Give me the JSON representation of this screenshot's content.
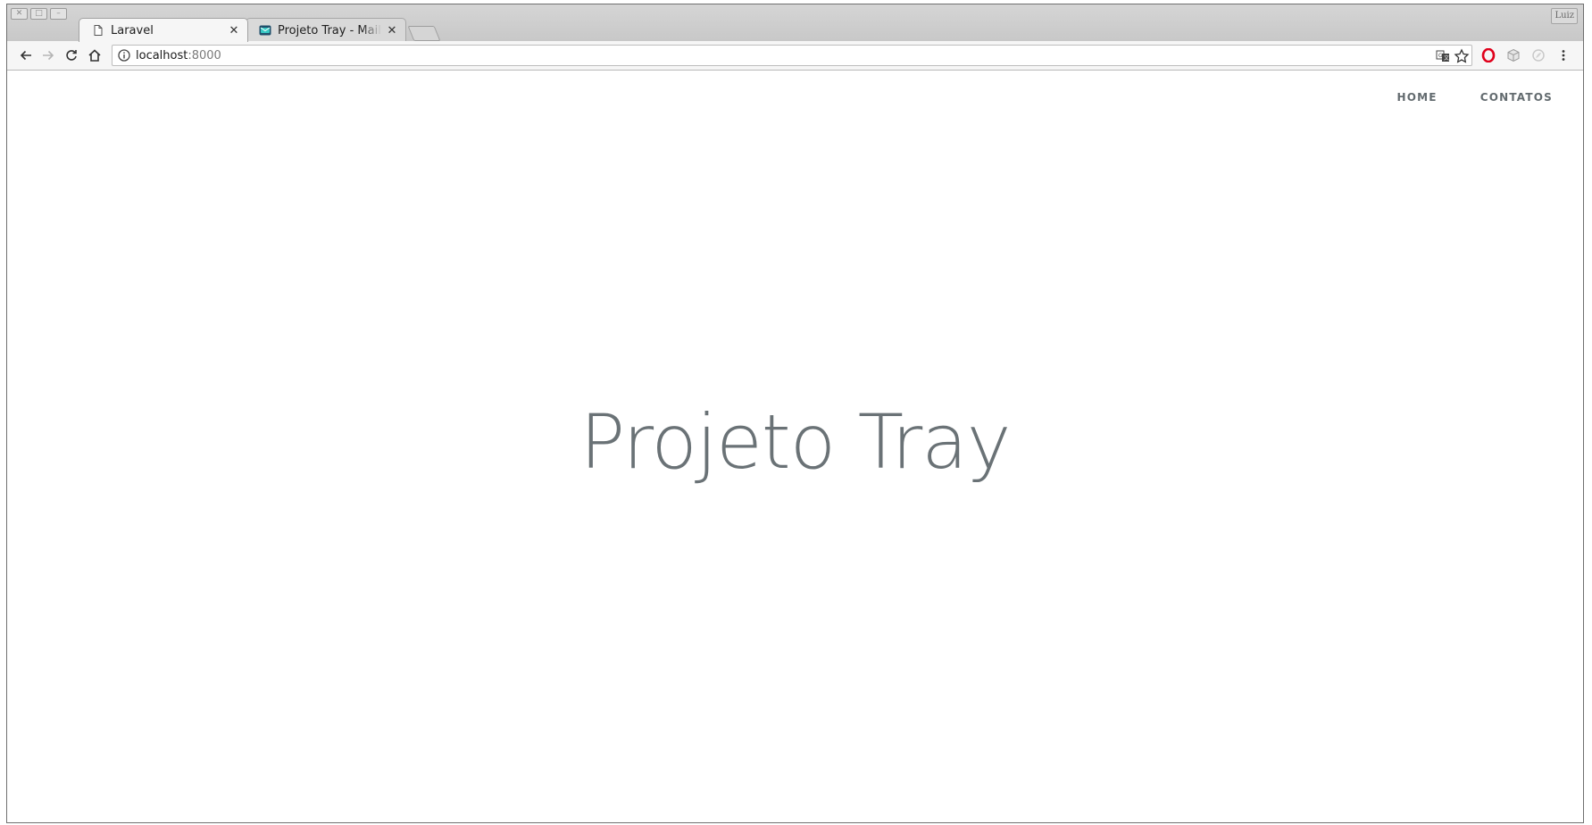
{
  "browser": {
    "profile_name": "Luiz",
    "tabs": [
      {
        "title": "Laravel",
        "active": true,
        "icon": "page-icon"
      },
      {
        "title": "Projeto Tray - Mailtra",
        "active": false,
        "icon": "mailtrap-icon"
      }
    ],
    "url": {
      "host": "localhost",
      "port": ":8000"
    }
  },
  "page": {
    "nav": [
      {
        "label": "Home"
      },
      {
        "label": "Contatos"
      }
    ],
    "title": "Projeto Tray"
  },
  "colors": {
    "text": "#636b6f",
    "background": "#ffffff",
    "opera_red": "#e0001b"
  }
}
